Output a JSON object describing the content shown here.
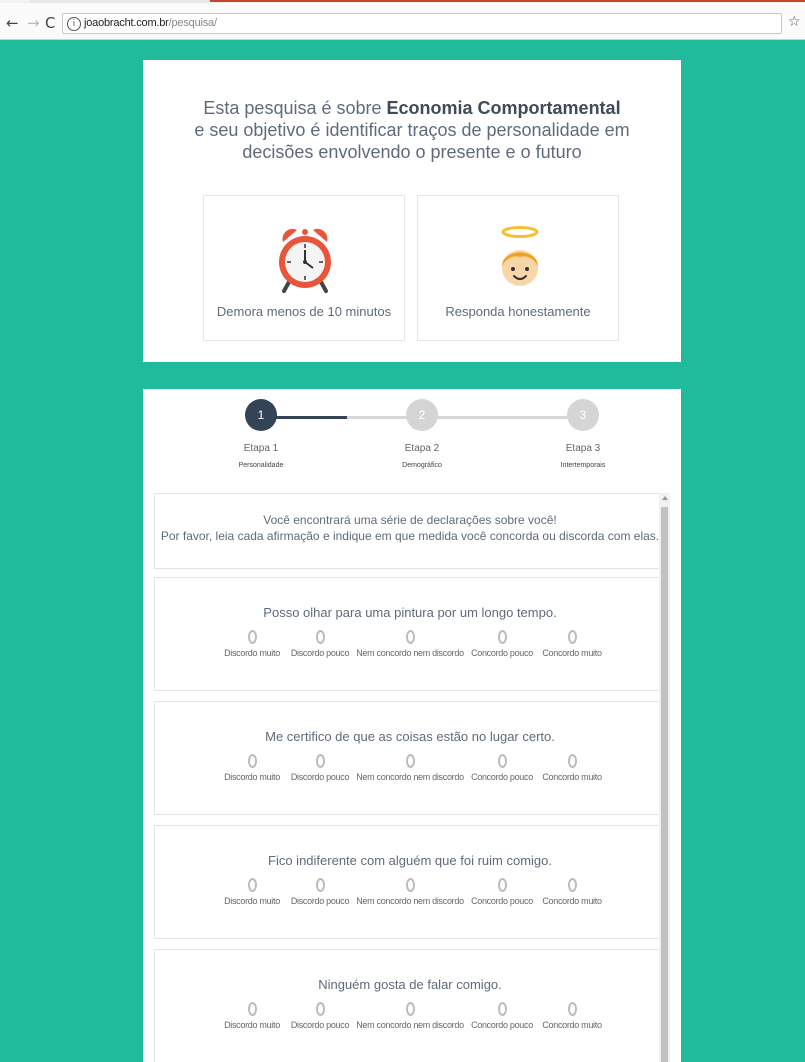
{
  "browser": {
    "url_host": "joaobracht.com.br",
    "url_path": "/pesquisa/"
  },
  "intro": {
    "title_prefix": "Esta pesquisa é sobre ",
    "title_bold": "Economia Comportamental",
    "title_line2": "e seu objetivo é identificar traços de personalidade em",
    "title_line3": "decisões envolvendo o presente e o futuro",
    "box1_caption": "Demora menos de 10 minutos",
    "box2_caption": "Responda honestamente"
  },
  "steps": [
    {
      "number": "1",
      "label": "Etapa 1",
      "sub": "Personalidade"
    },
    {
      "number": "2",
      "label": "Etapa 2",
      "sub": "Demográfico"
    },
    {
      "number": "3",
      "label": "Etapa 3",
      "sub": "Intertemporais"
    }
  ],
  "instructions": {
    "line1": "Você encontrará uma série de declarações sobre você!",
    "line2": "Por favor, leia cada afirmação e indique em que medida você concorda ou discorda com elas."
  },
  "options": [
    "Discordo muito",
    "Discordo pouco",
    "Nem concordo nem discordo",
    "Concordo pouco",
    "Concordo muito"
  ],
  "questions": [
    {
      "text": "Posso olhar para uma pintura por um longo tempo."
    },
    {
      "text": "Me certifico de que as coisas estão no lugar certo."
    },
    {
      "text": "Fico indiferente com alguém que foi ruim comigo."
    },
    {
      "text": "Ninguém gosta de falar comigo."
    }
  ],
  "colors": {
    "background": "#1fbb9a",
    "step_active": "#334457",
    "step_inactive": "#d5d5d5"
  }
}
